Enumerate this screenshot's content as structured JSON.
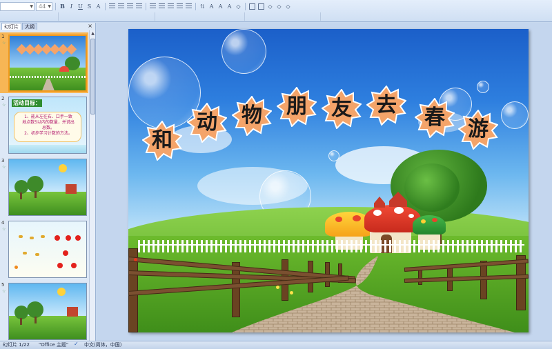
{
  "toolbar": {
    "font_name": "",
    "font_size": "44",
    "buttons": [
      "bold",
      "italic",
      "underline",
      "shadow",
      "font-effects",
      "align-left",
      "align-center",
      "align-right",
      "justify",
      "columns",
      "bullets",
      "numbering",
      "decrease-indent",
      "increase-indent",
      "text-direction",
      "font-color",
      "grow-font",
      "shrink-font",
      "clear-format",
      "arrange",
      "quick-styles",
      "shape-fill",
      "shape-outline",
      "shape-effects"
    ]
  },
  "panel": {
    "tabs": [
      {
        "label": "幻灯片"
      },
      {
        "label": "大纲"
      }
    ],
    "close_icon": "close-icon",
    "slides": [
      {
        "number": "1",
        "selected": true
      },
      {
        "number": "2",
        "title": "活动目标：",
        "lines": [
          "1、能从左往右、口手一致",
          "地点数5以内的数量，并说出",
          "总数。",
          "2、初步学习计数的方法。"
        ]
      },
      {
        "number": "3"
      },
      {
        "number": "4"
      },
      {
        "number": "5"
      }
    ]
  },
  "slide": {
    "title_chars": [
      "和",
      "动",
      "物",
      "朋",
      "友",
      "去",
      "春",
      "游"
    ],
    "colors": {
      "star_fill": "#f4a46a",
      "star_stroke": "#ffffff",
      "sky_top": "#1b5fc9",
      "grass": "#5ead2a"
    }
  },
  "status": {
    "slide_indicator": "幻灯片 1/22",
    "theme": "\"Office 主题\"",
    "language": "中文(简体，中国)"
  }
}
